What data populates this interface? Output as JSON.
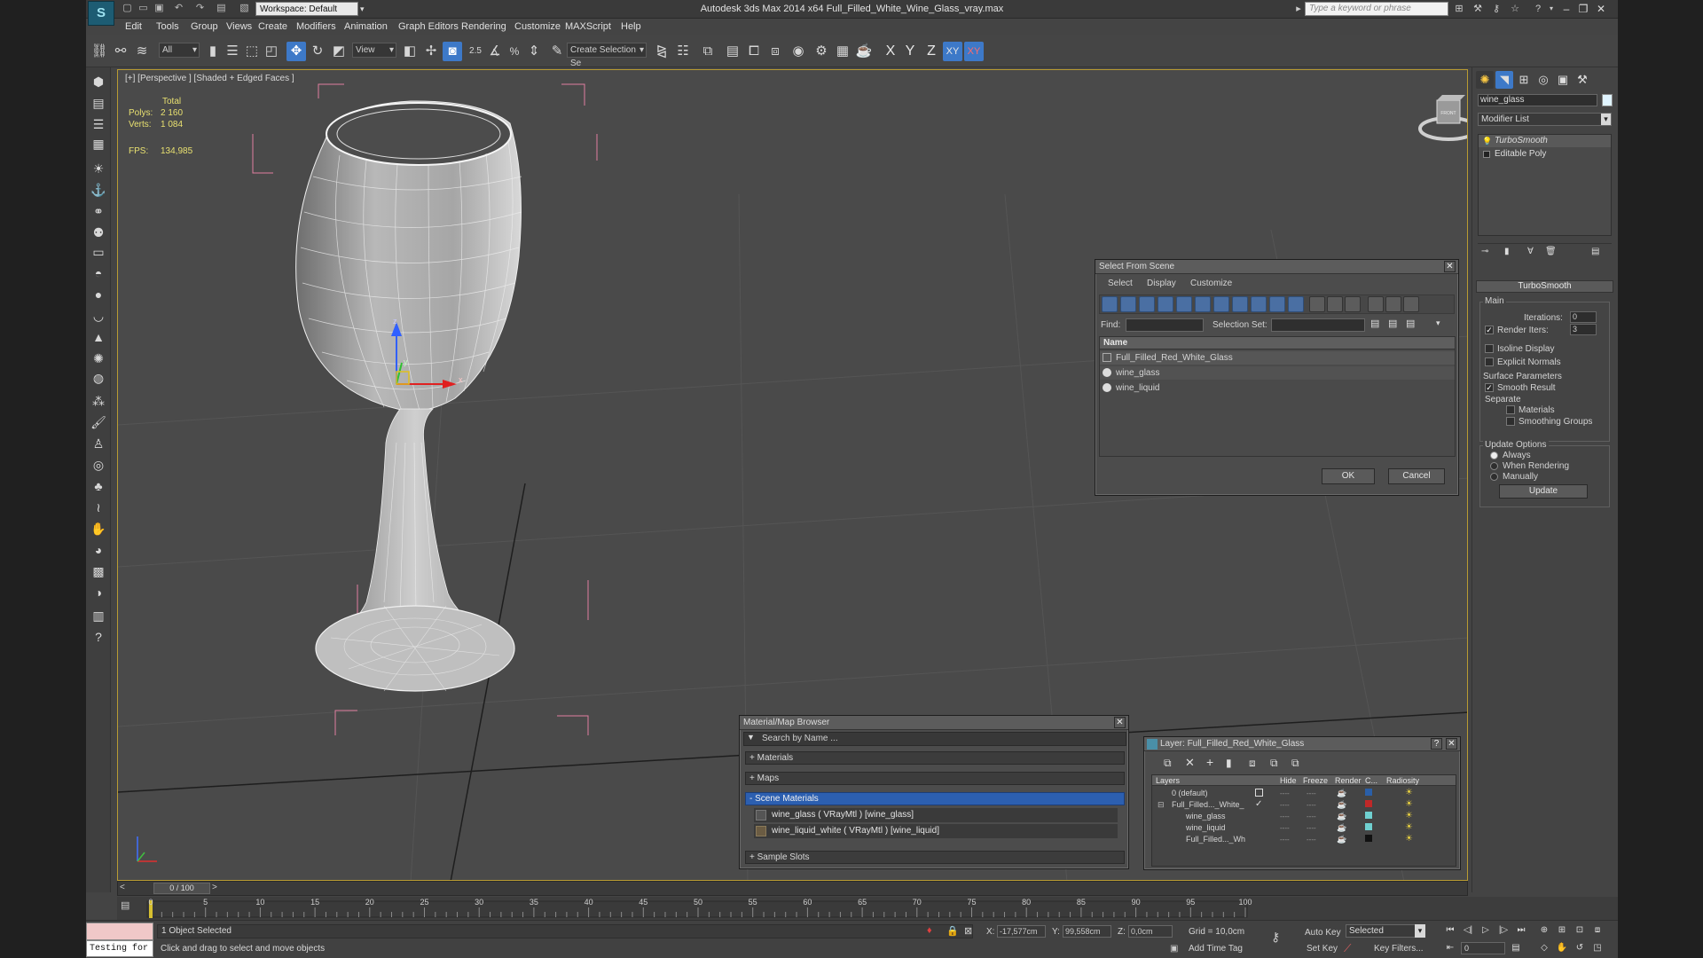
{
  "app": {
    "title": "Autodesk 3ds Max  2014 x64     Full_Filled_White_Wine_Glass_vray.max",
    "workspace": "Workspace: Default",
    "keyword_search_placeholder": "Type a keyword or phrase"
  },
  "menu": [
    "Edit",
    "Tools",
    "Group",
    "Views",
    "Create",
    "Modifiers",
    "Animation",
    "Graph Editors",
    "Rendering",
    "Customize",
    "MAXScript",
    "Help"
  ],
  "toolbar": {
    "selection_filter": "All",
    "ref_coord": "View",
    "snap_angle": "2.5",
    "named_selection_placeholder": "Create Selection Se",
    "axis_x": "X",
    "axis_y": "Y",
    "axis_z": "Z",
    "axis_xy": "XY",
    "axis_xy2": "XY"
  },
  "viewport": {
    "label": "[+] [Perspective ] [Shaded + Edged Faces ]",
    "stats": {
      "total_label": "Total",
      "polys_label": "Polys:",
      "polys": "2 160",
      "verts_label": "Verts:",
      "verts": "1 084",
      "fps_label": "FPS:",
      "fps": "134,985"
    },
    "gizmo_z": "z",
    "gizmo_y": "y",
    "gizmo_x": "x",
    "navcube_label": "FRONT"
  },
  "select_from_scene": {
    "title": "Select From Scene",
    "menu": [
      "Select",
      "Display",
      "Customize"
    ],
    "find_label": "Find:",
    "selection_set_label": "Selection Set:",
    "column_name": "Name",
    "rows": [
      "Full_Filled_Red_White_Glass",
      "wine_glass",
      "wine_liquid"
    ],
    "ok": "OK",
    "cancel": "Cancel"
  },
  "material_browser": {
    "title": "Material/Map Browser",
    "search_placeholder": "Search by Name ...",
    "sections": {
      "materials": "+ Materials",
      "maps": "+ Maps",
      "scene": "- Scene Materials",
      "samples": "+ Sample Slots"
    },
    "scene_items": [
      "wine_glass  ( VRayMtl ) [wine_glass]",
      "wine_liquid_white  ( VRayMtl ) [wine_liquid]"
    ]
  },
  "layer_dialog": {
    "title": "Layer: Full_Filled_Red_White_Glass",
    "help": "?",
    "columns": {
      "layers": "Layers",
      "hide": "Hide",
      "freeze": "Freeze",
      "render": "Render",
      "color": "C...",
      "radiosity": "Radiosity"
    },
    "rows": [
      {
        "name": "0 (default)",
        "color": "#2a5fa8"
      },
      {
        "name": "Full_Filled..._White_",
        "color": "#c02828"
      },
      {
        "name": "wine_glass",
        "color": "#6fd0d0"
      },
      {
        "name": "wine_liquid",
        "color": "#6fd0d0"
      },
      {
        "name": "Full_Filled..._Wh",
        "color": "#111111"
      }
    ]
  },
  "command_panel": {
    "object_name": "wine_glass",
    "modifier_list": "Modifier List",
    "stack": [
      "TurboSmooth",
      "Editable Poly"
    ],
    "rollout_title": "TurboSmooth",
    "main_label": "Main",
    "iterations_label": "Iterations:",
    "iterations": "0",
    "render_iters_label": "Render Iters:",
    "render_iters": "3",
    "isoline": "Isoline Display",
    "explicit_normals": "Explicit Normals",
    "surface_params": "Surface Parameters",
    "smooth_result": "Smooth Result",
    "separate": "Separate",
    "materials": "Materials",
    "smoothing_groups": "Smoothing Groups",
    "update_options": "Update Options",
    "always": "Always",
    "when_rendering": "When Rendering",
    "manually": "Manually",
    "update_button": "Update"
  },
  "timeline": {
    "frame": "0 / 100",
    "ticks": [
      "0",
      "5",
      "10",
      "15",
      "20",
      "25",
      "30",
      "35",
      "40",
      "45",
      "50",
      "55",
      "60",
      "65",
      "70",
      "75",
      "80",
      "85",
      "90",
      "95",
      "100"
    ]
  },
  "status": {
    "maxscript": "Testing for :",
    "selected": "1 Object Selected",
    "prompt": "Click and drag to select and move objects",
    "x_label": "X:",
    "x": "-17,577cm",
    "y_label": "Y:",
    "y": "99,558cm",
    "z_label": "Z:",
    "z": "0,0cm",
    "grid": "Grid = 10,0cm",
    "add_time_tag": "Add Time Tag",
    "auto_key": "Auto Key",
    "set_key": "Set Key",
    "selected_dd": "Selected",
    "key_filters": "Key Filters...",
    "frame_field": "0"
  }
}
